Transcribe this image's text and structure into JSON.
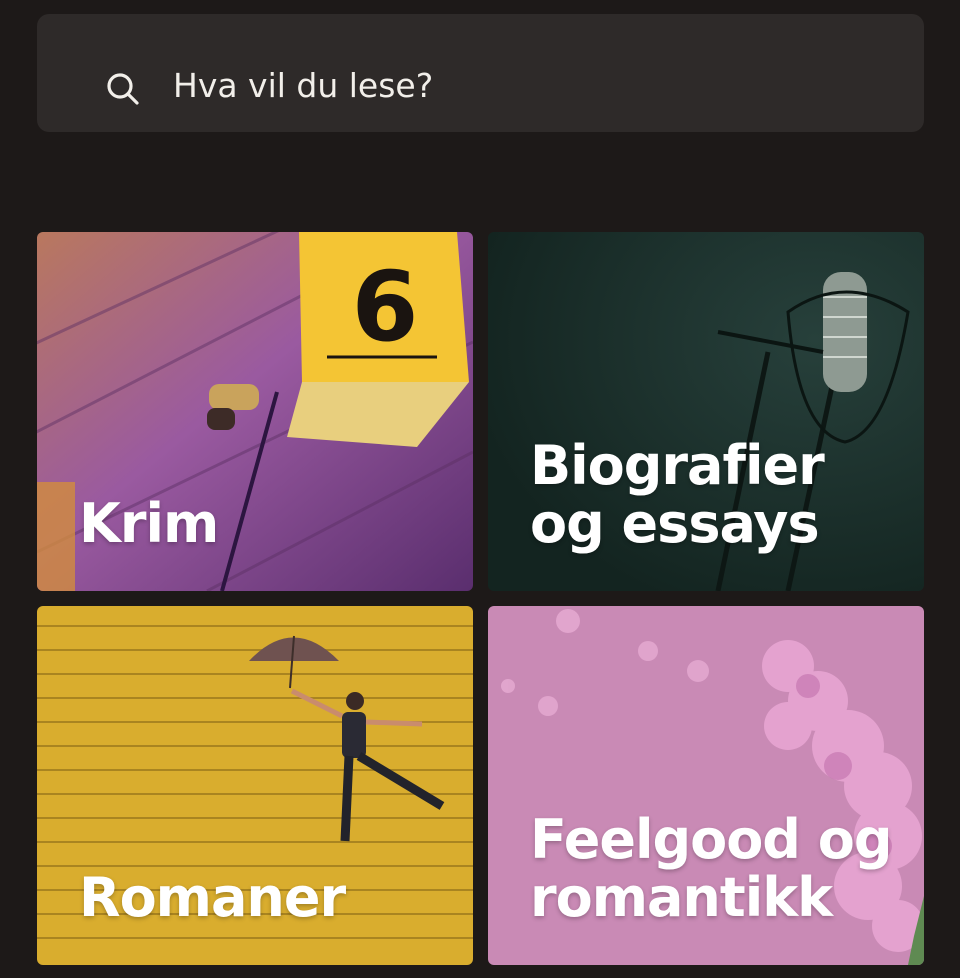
{
  "search": {
    "placeholder": "Hva vil du lese?",
    "icon": "search-icon"
  },
  "categories": [
    {
      "label": "Krim",
      "image": "crime-scene-evidence-marker",
      "marker_text": "6",
      "accent": "#f2c94c"
    },
    {
      "label": "Biografier\nog essays",
      "image": "studio-microphone",
      "accent": "#1e3531"
    },
    {
      "label": "Romaner",
      "image": "woman-with-umbrella-on-yellow-wall",
      "accent": "#d8ac2a"
    },
    {
      "label": "Feelgood og\nromantikk",
      "image": "lilac-flowers-on-pink",
      "accent": "#c98ab5"
    }
  ],
  "colors": {
    "background": "#1d1918",
    "search_background": "#2e2a29",
    "text": "#f2efea"
  }
}
